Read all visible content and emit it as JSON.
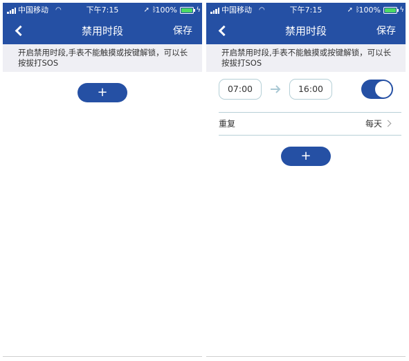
{
  "status_bar": {
    "carrier": "中国移动",
    "time": "下午7:15",
    "battery_pct": "100%"
  },
  "nav": {
    "title": "禁用时段",
    "save_label": "保存"
  },
  "hint_text": "开启禁用时段,手表不能触摸或按键解锁，可以长按拔打SOS",
  "add_label": "+",
  "period": {
    "start": "07:00",
    "end": "16:00",
    "enabled": true
  },
  "repeat": {
    "label": "重复",
    "value": "每天"
  },
  "colors": {
    "brand_blue": "#2550a4",
    "hint_bg": "#efeff4",
    "time_border": "#b4cfd6",
    "battery_green": "#4cd964"
  }
}
